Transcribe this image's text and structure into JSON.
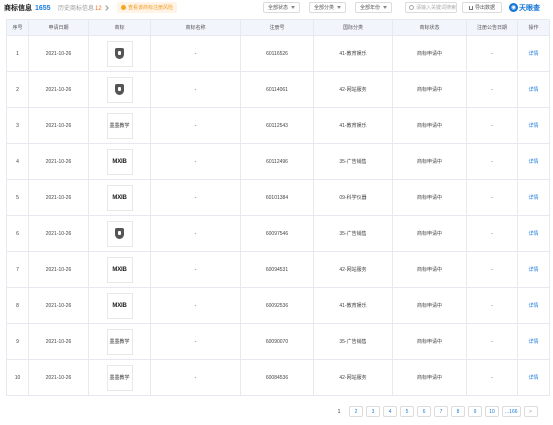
{
  "header": {
    "title": "商标信息",
    "count": "1655",
    "history_label": "历史商标信息",
    "history_count": "12",
    "tip": "查看该商标注册风险"
  },
  "filters": [
    {
      "label": "全部状态"
    },
    {
      "label": "全部分类"
    },
    {
      "label": "全部年份"
    }
  ],
  "search": {
    "placeholder": "请输入关键词搜索"
  },
  "export_label": "导出数据",
  "brand": {
    "name": "天眼查",
    "icon": "eye-logo"
  },
  "table": {
    "columns": [
      "序号",
      "申请日期",
      "商标",
      "商标名称",
      "注册号",
      "国际分类",
      "商标状态",
      "注册公告日期",
      "操作"
    ],
    "rows": [
      {
        "no": "1",
        "date": "2021-10-26",
        "logo": "shield",
        "name": "-",
        "reg": "60116526",
        "cls": "41-教育娱乐",
        "status": "商标申请中",
        "notice": "-",
        "action": "详情"
      },
      {
        "no": "2",
        "date": "2021-10-26",
        "logo": "shield",
        "name": "-",
        "reg": "60114061",
        "cls": "42-网站服务",
        "status": "商标申请中",
        "notice": "-",
        "action": "详情"
      },
      {
        "no": "3",
        "date": "2021-10-26",
        "logo": "cn",
        "logo_text": "墨墨教学",
        "name": "-",
        "reg": "60112543",
        "cls": "41-教育娱乐",
        "status": "商标申请中",
        "notice": "-",
        "action": "详情"
      },
      {
        "no": "4",
        "date": "2021-10-26",
        "logo": "mx",
        "logo_text": "MXIB",
        "name": "-",
        "reg": "60112496",
        "cls": "35-广告销售",
        "status": "商标申请中",
        "notice": "-",
        "action": "详情"
      },
      {
        "no": "5",
        "date": "2021-10-26",
        "logo": "mx",
        "logo_text": "MXIB",
        "name": "-",
        "reg": "60101384",
        "cls": "09-科学仪器",
        "status": "商标申请中",
        "notice": "-",
        "action": "详情"
      },
      {
        "no": "6",
        "date": "2021-10-26",
        "logo": "shield",
        "name": "-",
        "reg": "60097546",
        "cls": "35-广告销售",
        "status": "商标申请中",
        "notice": "-",
        "action": "详情"
      },
      {
        "no": "7",
        "date": "2021-10-26",
        "logo": "mx",
        "logo_text": "MXIB",
        "name": "-",
        "reg": "60094531",
        "cls": "42-网站服务",
        "status": "商标申请中",
        "notice": "-",
        "action": "详情"
      },
      {
        "no": "8",
        "date": "2021-10-26",
        "logo": "mx",
        "logo_text": "MXIB",
        "name": "-",
        "reg": "60092536",
        "cls": "41-教育娱乐",
        "status": "商标申请中",
        "notice": "-",
        "action": "详情"
      },
      {
        "no": "9",
        "date": "2021-10-26",
        "logo": "cn",
        "logo_text": "墨墨教学",
        "name": "-",
        "reg": "60090070",
        "cls": "35-广告销售",
        "status": "商标申请中",
        "notice": "-",
        "action": "详情"
      },
      {
        "no": "10",
        "date": "2021-10-26",
        "logo": "cn",
        "logo_text": "墨墨教学",
        "name": "-",
        "reg": "60084536",
        "cls": "42-网站服务",
        "status": "商标申请中",
        "notice": "-",
        "action": "详情"
      }
    ]
  },
  "pagination": {
    "pages": [
      "1",
      "2",
      "3",
      "4",
      "5",
      "6",
      "7",
      "8",
      "9",
      "10",
      "...166"
    ],
    "current": "1",
    "next": ">"
  }
}
